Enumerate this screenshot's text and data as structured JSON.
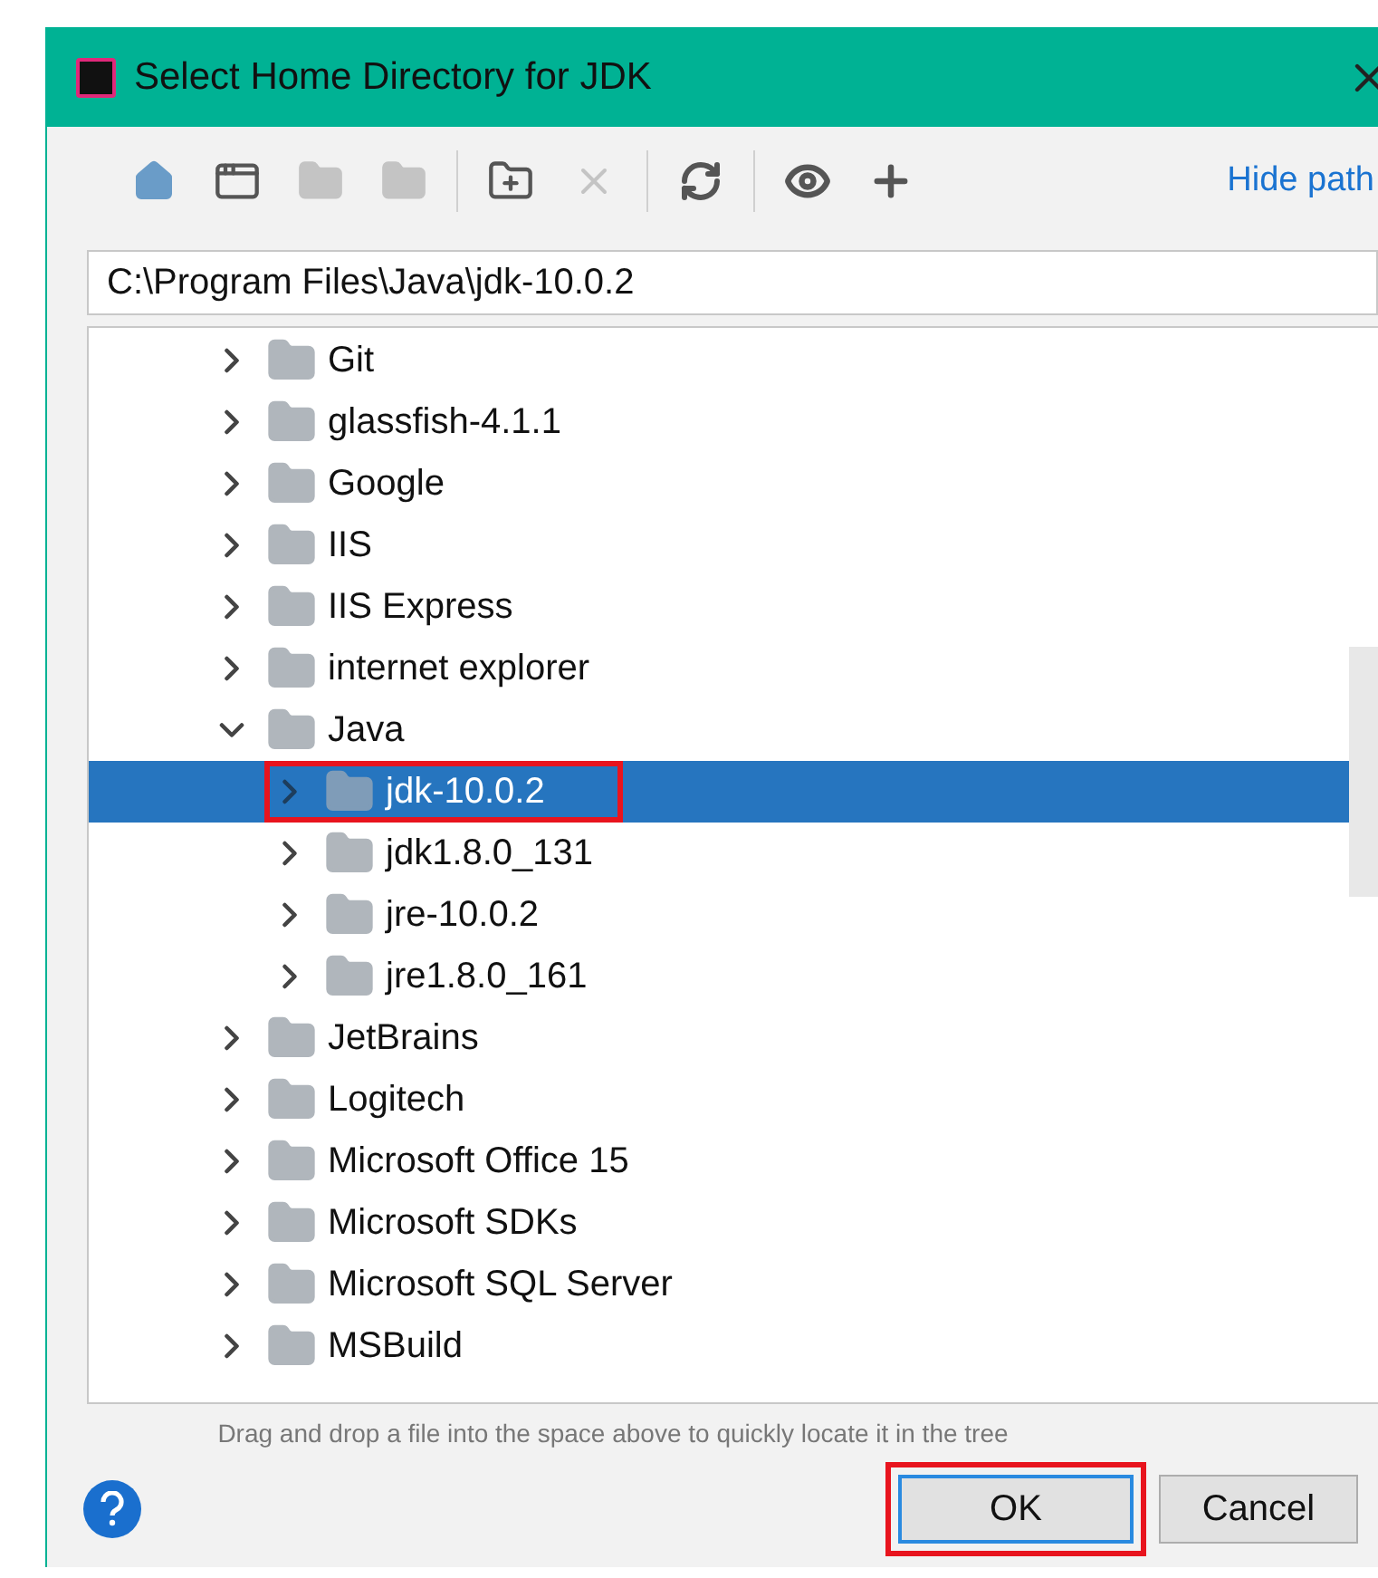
{
  "window": {
    "title": "Select Home Directory for JDK"
  },
  "toolbar": [
    {
      "kind": "home",
      "disabled": false
    },
    {
      "kind": "window",
      "disabled": false
    },
    {
      "kind": "folder",
      "disabled": true
    },
    {
      "kind": "folder",
      "disabled": true
    },
    {
      "kind": "separator"
    },
    {
      "kind": "new-folder",
      "disabled": false
    },
    {
      "kind": "delete",
      "disabled": true
    },
    {
      "kind": "separator"
    },
    {
      "kind": "refresh",
      "disabled": false
    },
    {
      "kind": "separator"
    },
    {
      "kind": "hidden",
      "disabled": false
    },
    {
      "kind": "add",
      "disabled": false
    }
  ],
  "hide_path_link": "Hide path",
  "path_field": {
    "value": "C:\\Program Files\\Java\\jdk-10.0.2"
  },
  "tree": [
    {
      "label": "Git",
      "expanded": false,
      "selected": false,
      "highlighted": false
    },
    {
      "label": "glassfish-4.1.1",
      "expanded": false,
      "selected": false,
      "highlighted": false
    },
    {
      "label": "Google",
      "expanded": false,
      "selected": false,
      "highlighted": false
    },
    {
      "label": "IIS",
      "expanded": false,
      "selected": false,
      "highlighted": false
    },
    {
      "label": "IIS Express",
      "expanded": false,
      "selected": false,
      "highlighted": false
    },
    {
      "label": "internet explorer",
      "expanded": false,
      "selected": false,
      "highlighted": false
    },
    {
      "label": "Java",
      "expanded": true,
      "selected": false,
      "highlighted": false,
      "children": [
        {
          "label": "jdk-10.0.2",
          "expanded": false,
          "selected": true,
          "highlighted": true
        },
        {
          "label": "jdk1.8.0_131",
          "expanded": false,
          "selected": false,
          "highlighted": false
        },
        {
          "label": "jre-10.0.2",
          "expanded": false,
          "selected": false,
          "highlighted": false
        },
        {
          "label": "jre1.8.0_161",
          "expanded": false,
          "selected": false,
          "highlighted": false
        }
      ]
    },
    {
      "label": "JetBrains",
      "expanded": false,
      "selected": false,
      "highlighted": false
    },
    {
      "label": "Logitech",
      "expanded": false,
      "selected": false,
      "highlighted": false
    },
    {
      "label": "Microsoft Office 15",
      "expanded": false,
      "selected": false,
      "highlighted": false
    },
    {
      "label": "Microsoft SDKs",
      "expanded": false,
      "selected": false,
      "highlighted": false
    },
    {
      "label": "Microsoft SQL Server",
      "expanded": false,
      "selected": false,
      "highlighted": false
    },
    {
      "label": "MSBuild",
      "expanded": false,
      "selected": false,
      "highlighted": false
    }
  ],
  "hint": "Drag and drop a file into the space above to quickly locate it in the tree",
  "buttons": [
    {
      "label": "OK",
      "kind": "default",
      "highlighted": true
    },
    {
      "label": "Cancel",
      "kind": "normal",
      "highlighted": false
    }
  ]
}
